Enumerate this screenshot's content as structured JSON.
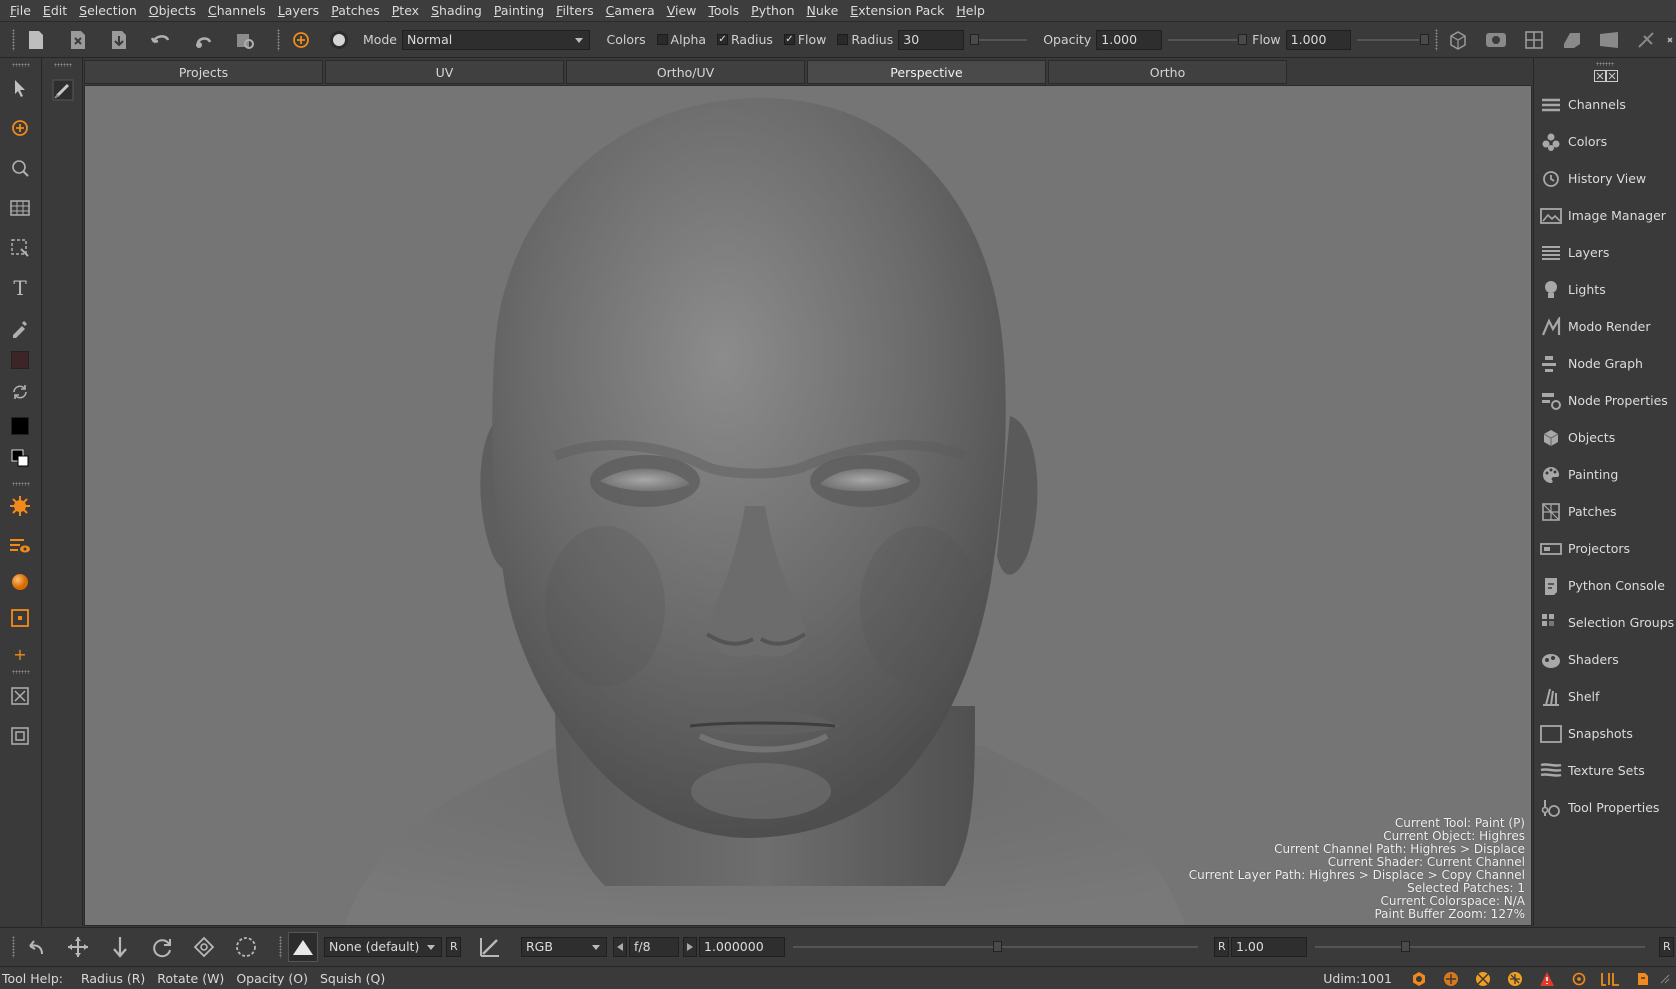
{
  "menu": {
    "items": [
      {
        "first": "F",
        "rest": "ile"
      },
      {
        "first": "E",
        "rest": "dit"
      },
      {
        "first": "S",
        "rest": "election"
      },
      {
        "first": "O",
        "rest": "bjects"
      },
      {
        "first": "C",
        "rest": "hannels"
      },
      {
        "first": "L",
        "rest": "ayers"
      },
      {
        "first": "P",
        "rest": "atches"
      },
      {
        "first": "P",
        "rest": "tex"
      },
      {
        "first": "S",
        "rest": "hading"
      },
      {
        "first": "P",
        "rest": "ainting"
      },
      {
        "first": "F",
        "rest": "ilters"
      },
      {
        "first": "C",
        "rest": "amera"
      },
      {
        "first": "V",
        "rest": "iew"
      },
      {
        "first": "T",
        "rest": "ools"
      },
      {
        "first": "P",
        "rest": "ython"
      },
      {
        "first": "N",
        "rest": "uke"
      },
      {
        "first": "E",
        "rest": "xtension Pack"
      },
      {
        "first": "H",
        "rest": "elp"
      }
    ]
  },
  "toolbar": {
    "mode_label": "Mode",
    "mode_value": "Normal",
    "colors_label": "Colors",
    "alpha_label": "Alpha",
    "alpha_checked": "",
    "radius_check_label": "Radius",
    "radius_checked": "✓",
    "flow_check_label": "Flow",
    "flow_checked": "✓",
    "radius_label": "Radius",
    "radius_value": "30",
    "opacity_label": "Opacity",
    "opacity_value": "1.000",
    "flow_label": "Flow",
    "flow_value": "1.000"
  },
  "viewer_tabs": [
    {
      "label": "Projects"
    },
    {
      "label": "UV"
    },
    {
      "label": "Ortho/UV"
    },
    {
      "label": "Perspective"
    },
    {
      "label": "Ortho"
    }
  ],
  "hud": {
    "lines": [
      "Current Tool: Paint (P)",
      "Current Object: Highres",
      "Current Channel Path: Highres > Displace",
      "Current Shader: Current Channel",
      "Current Layer Path: Highres > Displace > Copy Channel",
      "Selected Patches: 1",
      "Current Colorspace: N/A",
      "Paint Buffer Zoom: 127%"
    ]
  },
  "right_panel": {
    "items": [
      {
        "label": "Channels",
        "icon": "channels-icon"
      },
      {
        "label": "Colors",
        "icon": "colors-icon"
      },
      {
        "label": "History View",
        "icon": "history-icon"
      },
      {
        "label": "Image Manager",
        "icon": "image-manager-icon"
      },
      {
        "label": "Layers",
        "icon": "layers-icon"
      },
      {
        "label": "Lights",
        "icon": "lightbulb-icon"
      },
      {
        "label": "Modo Render",
        "icon": "modo-render-icon"
      },
      {
        "label": "Node Graph",
        "icon": "node-graph-icon"
      },
      {
        "label": "Node Properties",
        "icon": "node-properties-icon"
      },
      {
        "label": "Objects",
        "icon": "objects-icon"
      },
      {
        "label": "Painting",
        "icon": "palette-icon"
      },
      {
        "label": "Patches",
        "icon": "patches-icon"
      },
      {
        "label": "Projectors",
        "icon": "projector-icon"
      },
      {
        "label": "Python Console",
        "icon": "python-console-icon"
      },
      {
        "label": "Selection Groups",
        "icon": "selection-groups-icon"
      },
      {
        "label": "Shaders",
        "icon": "shaders-icon"
      },
      {
        "label": "Shelf",
        "icon": "shelf-icon"
      },
      {
        "label": "Snapshots",
        "icon": "snapshots-icon"
      },
      {
        "label": "Texture Sets",
        "icon": "texture-sets-icon"
      },
      {
        "label": "Tool Properties",
        "icon": "tool-properties-icon"
      }
    ]
  },
  "bottom_toolbar": {
    "lut_value": "None (default)",
    "r_label": "R",
    "channel_value": "RGB",
    "fstop_value": "f/8",
    "exposure_value": "1.000000",
    "gamma_label": "R",
    "gamma_value": "1.00",
    "end_label": "R"
  },
  "statusbar": {
    "tool_help": "Tool Help:",
    "radius": "Radius (R)",
    "rotate": "Rotate (W)",
    "opacity": "Opacity (O)",
    "squish": "Squish (Q)",
    "udim": "Udim:1001"
  },
  "colors": {
    "accent": "#f08a1c",
    "viewport_bg": "#757575",
    "panel_bg": "#3a3a3a",
    "warning": "#e03a2a"
  }
}
